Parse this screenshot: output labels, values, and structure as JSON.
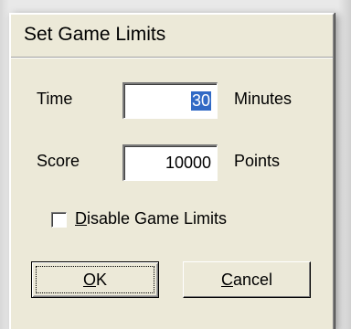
{
  "dialog": {
    "title": "Set Game Limits"
  },
  "time": {
    "label": "Time",
    "value": "30",
    "unit": "Minutes"
  },
  "score": {
    "label": "Score",
    "value": "10000",
    "unit": "Points"
  },
  "disable_limits": {
    "mnemonic": "D",
    "label_rest": "isable Game Limits",
    "checked": false
  },
  "buttons": {
    "ok_mnemonic": "O",
    "ok_rest": "K",
    "cancel_mnemonic": "C",
    "cancel_rest": "ancel"
  }
}
